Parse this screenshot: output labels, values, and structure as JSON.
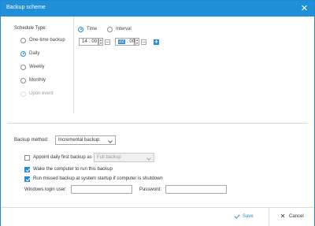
{
  "window": {
    "title": "Backup scheme",
    "close_icon": "close-icon"
  },
  "schedule": {
    "label": "Schedule Type:",
    "options": [
      {
        "label": "One-time backup",
        "checked": false,
        "disabled": false
      },
      {
        "label": "Daily",
        "checked": true,
        "disabled": false
      },
      {
        "label": "Weekly",
        "checked": false,
        "disabled": false
      },
      {
        "label": "Monthly",
        "checked": false,
        "disabled": false
      },
      {
        "label": "Upon event",
        "checked": false,
        "disabled": true,
        "icon": "gear-icon"
      }
    ]
  },
  "time_mode": {
    "time_label": "Time",
    "time_checked": true,
    "interval_label": "Interval",
    "interval_checked": false
  },
  "time_entries": [
    {
      "hour": "14",
      "minute": "00"
    },
    {
      "hour": "22",
      "minute": "00"
    }
  ],
  "backup_method": {
    "label": "Backup method:",
    "value": "Incremental backup"
  },
  "options": {
    "appoint_label": "Appoint daily first backup as",
    "appoint_checked": false,
    "appoint_value": "Full backup",
    "wake_label": "Wake the computer to run this backup",
    "wake_checked": true,
    "missed_label": "Run missed backup at system startup if computer is shutdown",
    "missed_checked": true
  },
  "login": {
    "user_label": "Windows login user:",
    "user_value": "",
    "password_label": "Password:",
    "password_value": ""
  },
  "footer": {
    "save_label": "Save",
    "cancel_label": "Cancel"
  },
  "colors": {
    "accent": "#1f8fd9",
    "title_bar": "#1f8fd9"
  }
}
